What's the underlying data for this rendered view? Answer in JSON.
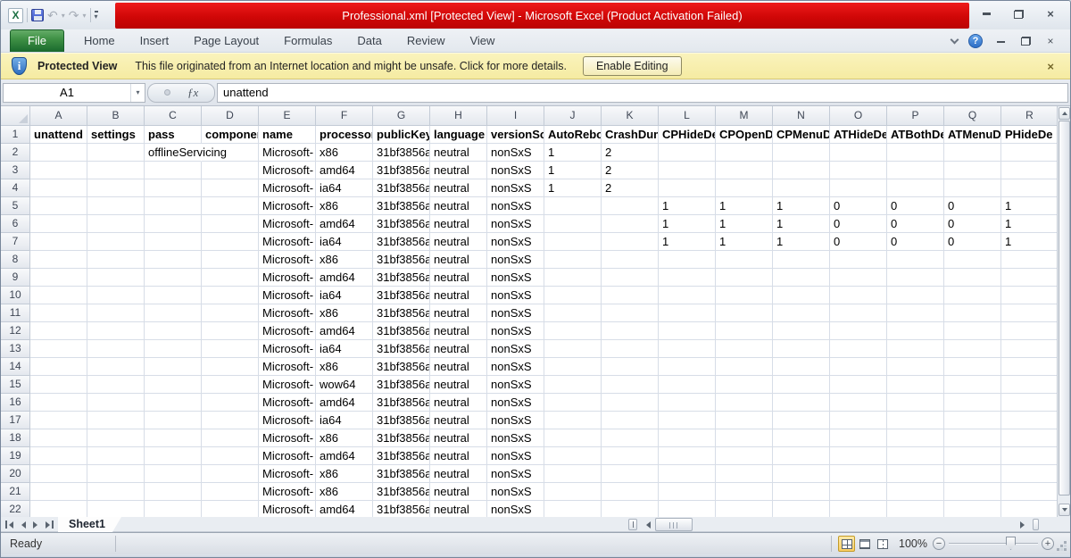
{
  "window": {
    "title": "Professional.xml  [Protected View]  -  Microsoft Excel (Product Activation Failed)"
  },
  "icons": {
    "excel_logo": "X",
    "undo": "↶",
    "redo": "↷",
    "dropdown": "▾",
    "help": "?",
    "info": "i",
    "close": "×",
    "fx": "ƒx",
    "minus": "−",
    "plus": "+"
  },
  "colors": {
    "titlebar_red": "#d00707",
    "file_tab_green": "#3f9145",
    "protected_view_yellow": "#f8f0ae",
    "active_view_button_orange": "#fbce63",
    "help_blue": "#2e6ec6"
  },
  "ribbon": {
    "tabs": [
      "File",
      "Home",
      "Insert",
      "Page Layout",
      "Formulas",
      "Data",
      "Review",
      "View"
    ],
    "active_tab": "File"
  },
  "protected_view": {
    "label": "Protected View",
    "message": "This file originated from an Internet location and might be unsafe. Click for more details.",
    "button": "Enable Editing"
  },
  "formula_bar": {
    "name_box": "A1",
    "formula": "unattend"
  },
  "sheet": {
    "name": "Sheet1",
    "col_headers": [
      "A",
      "B",
      "C",
      "D",
      "E",
      "F",
      "G",
      "H",
      "I",
      "J",
      "K",
      "L",
      "M",
      "N",
      "O",
      "P",
      "Q",
      "R"
    ],
    "header_row": [
      "unattend",
      "settings",
      "pass",
      "componen",
      "name",
      "processor",
      "publicKey",
      "language",
      "versionSc",
      "AutoRebo",
      "CrashDum",
      "CPHideDe",
      "CPOpenD",
      "CPMenuD",
      "ATHideDe",
      "ATBothDe",
      "ATMenuD",
      "PHideDe"
    ],
    "data_rows": [
      [
        "",
        "",
        "offlineServicing",
        "",
        "Microsoft-",
        "x86",
        "31bf3856a",
        "neutral",
        "nonSxS",
        "1",
        "2",
        "",
        "",
        "",
        "",
        "",
        "",
        ""
      ],
      [
        "",
        "",
        "",
        "",
        "Microsoft-",
        "amd64",
        "31bf3856a",
        "neutral",
        "nonSxS",
        "1",
        "2",
        "",
        "",
        "",
        "",
        "",
        "",
        ""
      ],
      [
        "",
        "",
        "",
        "",
        "Microsoft-",
        "ia64",
        "31bf3856a",
        "neutral",
        "nonSxS",
        "1",
        "2",
        "",
        "",
        "",
        "",
        "",
        "",
        ""
      ],
      [
        "",
        "",
        "",
        "",
        "Microsoft-",
        "x86",
        "31bf3856a",
        "neutral",
        "nonSxS",
        "",
        "",
        "1",
        "1",
        "1",
        "0",
        "0",
        "0",
        "1"
      ],
      [
        "",
        "",
        "",
        "",
        "Microsoft-",
        "amd64",
        "31bf3856a",
        "neutral",
        "nonSxS",
        "",
        "",
        "1",
        "1",
        "1",
        "0",
        "0",
        "0",
        "1"
      ],
      [
        "",
        "",
        "",
        "",
        "Microsoft-",
        "ia64",
        "31bf3856a",
        "neutral",
        "nonSxS",
        "",
        "",
        "1",
        "1",
        "1",
        "0",
        "0",
        "0",
        "1"
      ],
      [
        "",
        "",
        "",
        "",
        "Microsoft-",
        "x86",
        "31bf3856a",
        "neutral",
        "nonSxS",
        "",
        "",
        "",
        "",
        "",
        "",
        "",
        "",
        ""
      ],
      [
        "",
        "",
        "",
        "",
        "Microsoft-",
        "amd64",
        "31bf3856a",
        "neutral",
        "nonSxS",
        "",
        "",
        "",
        "",
        "",
        "",
        "",
        "",
        ""
      ],
      [
        "",
        "",
        "",
        "",
        "Microsoft-",
        "ia64",
        "31bf3856a",
        "neutral",
        "nonSxS",
        "",
        "",
        "",
        "",
        "",
        "",
        "",
        "",
        ""
      ],
      [
        "",
        "",
        "",
        "",
        "Microsoft-",
        "x86",
        "31bf3856a",
        "neutral",
        "nonSxS",
        "",
        "",
        "",
        "",
        "",
        "",
        "",
        "",
        ""
      ],
      [
        "",
        "",
        "",
        "",
        "Microsoft-",
        "amd64",
        "31bf3856a",
        "neutral",
        "nonSxS",
        "",
        "",
        "",
        "",
        "",
        "",
        "",
        "",
        ""
      ],
      [
        "",
        "",
        "",
        "",
        "Microsoft-",
        "ia64",
        "31bf3856a",
        "neutral",
        "nonSxS",
        "",
        "",
        "",
        "",
        "",
        "",
        "",
        "",
        ""
      ],
      [
        "",
        "",
        "",
        "",
        "Microsoft-",
        "x86",
        "31bf3856a",
        "neutral",
        "nonSxS",
        "",
        "",
        "",
        "",
        "",
        "",
        "",
        "",
        ""
      ],
      [
        "",
        "",
        "",
        "",
        "Microsoft-",
        "wow64",
        "31bf3856a",
        "neutral",
        "nonSxS",
        "",
        "",
        "",
        "",
        "",
        "",
        "",
        "",
        ""
      ],
      [
        "",
        "",
        "",
        "",
        "Microsoft-",
        "amd64",
        "31bf3856a",
        "neutral",
        "nonSxS",
        "",
        "",
        "",
        "",
        "",
        "",
        "",
        "",
        ""
      ],
      [
        "",
        "",
        "",
        "",
        "Microsoft-",
        "ia64",
        "31bf3856a",
        "neutral",
        "nonSxS",
        "",
        "",
        "",
        "",
        "",
        "",
        "",
        "",
        ""
      ],
      [
        "",
        "",
        "",
        "",
        "Microsoft-",
        "x86",
        "31bf3856a",
        "neutral",
        "nonSxS",
        "",
        "",
        "",
        "",
        "",
        "",
        "",
        "",
        ""
      ],
      [
        "",
        "",
        "",
        "",
        "Microsoft-",
        "amd64",
        "31bf3856a",
        "neutral",
        "nonSxS",
        "",
        "",
        "",
        "",
        "",
        "",
        "",
        "",
        ""
      ],
      [
        "",
        "",
        "",
        "",
        "Microsoft-",
        "x86",
        "31bf3856a",
        "neutral",
        "nonSxS",
        "",
        "",
        "",
        "",
        "",
        "",
        "",
        "",
        ""
      ],
      [
        "",
        "",
        "",
        "",
        "Microsoft-",
        "x86",
        "31bf3856a",
        "neutral",
        "nonSxS",
        "",
        "",
        "",
        "",
        "",
        "",
        "",
        "",
        ""
      ],
      [
        "",
        "",
        "",
        "",
        "Microsoft-",
        "amd64",
        "31bf3856a",
        "neutral",
        "nonSxS",
        "",
        "",
        "",
        "",
        "",
        "",
        "",
        "",
        ""
      ]
    ]
  },
  "status_bar": {
    "mode": "Ready",
    "zoom_level": "100%"
  }
}
